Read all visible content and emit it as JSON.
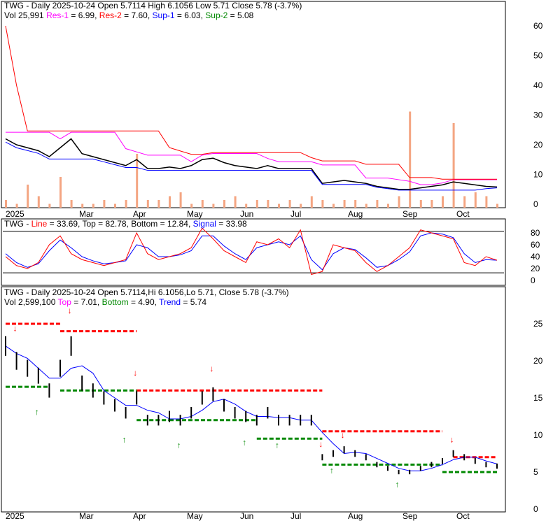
{
  "chart_data": [
    {
      "type": "line",
      "panel": "price-overview",
      "title": "TWG - Daily 2025-10-24 Open 5.7114  High 6.1056  Low 5.71  Close 5.78 (-3.7%)",
      "legend": {
        "vol": "Vol 25,991",
        "res1": "Res-1",
        "res1_val": " = 6.99,",
        "res2": "Res-2",
        "res2_val": " = 7.60,",
        "sup1": "Sup-1",
        "sup1_val": " = 6.03,",
        "sup2": "Sup-2",
        "sup2_val": " = 5.08"
      },
      "ylim": [
        0,
        65
      ],
      "yticks": [
        0,
        10,
        20,
        30,
        40,
        50,
        60
      ],
      "volume": [
        2,
        1,
        6,
        3,
        1,
        8,
        2,
        1,
        1,
        2,
        1,
        2,
        14,
        2,
        2,
        3,
        4,
        1,
        2,
        1,
        2,
        3,
        1,
        2,
        2,
        1,
        2,
        1,
        3,
        2,
        1,
        2,
        2,
        1,
        2,
        1,
        3,
        25,
        2,
        2,
        3,
        22,
        3,
        4,
        3,
        1
      ]
    },
    {
      "type": "line",
      "panel": "stochastic",
      "legend": {
        "prefix": "TWG - ",
        "line": "Line",
        "line_val": " = 33.69, Top = 82.78, Bottom = 12.84, ",
        "signal": "Signal",
        "signal_val": " = 33.98"
      },
      "ylim": [
        0,
        90
      ],
      "yticks": [
        0,
        20,
        40,
        60,
        80
      ],
      "line": [
        40,
        25,
        20,
        30,
        60,
        75,
        45,
        35,
        30,
        25,
        30,
        35,
        80,
        45,
        35,
        40,
        45,
        55,
        88,
        70,
        50,
        40,
        30,
        65,
        60,
        70,
        55,
        85,
        10,
        15,
        60,
        55,
        50,
        30,
        15,
        25,
        40,
        55,
        85,
        80,
        75,
        70,
        30,
        25,
        40,
        34
      ],
      "signal": [
        45,
        30,
        22,
        28,
        50,
        68,
        55,
        40,
        33,
        28,
        30,
        33,
        60,
        55,
        40,
        40,
        43,
        50,
        75,
        75,
        58,
        45,
        35,
        55,
        60,
        65,
        60,
        75,
        35,
        18,
        45,
        55,
        52,
        38,
        22,
        25,
        35,
        48,
        75,
        80,
        78,
        72,
        45,
        30,
        35,
        34
      ]
    },
    {
      "type": "line",
      "panel": "price-detail",
      "title": "TWG - Daily 2025-10-24 Open 5.7114,Hi 6.1056,Lo 5.71,  Close 5.78 (-3.7%)",
      "legend": {
        "vol": "Vol 2,599,100",
        "top": "Top",
        "top_val": " = 7.01,",
        "bottom": "Bottom",
        "bottom_val": " = 4.90,",
        "trend": "Trend",
        "trend_val": " = 5.74"
      },
      "ylim": [
        0,
        27
      ],
      "yticks": [
        0,
        5,
        10,
        15,
        20,
        25
      ],
      "close": [
        22,
        20,
        19,
        18,
        16,
        19,
        22,
        17,
        16,
        15,
        14,
        13,
        15,
        12,
        12,
        12.5,
        12,
        13,
        15,
        15.5,
        14,
        13,
        12.5,
        12,
        13,
        12,
        12,
        12,
        12,
        7,
        7.5,
        8,
        7.5,
        7,
        6,
        5.5,
        5,
        5,
        5.5,
        6,
        6.5,
        7.5,
        7,
        6.5,
        6,
        5.8
      ],
      "resistance": [
        [
          0,
          5,
          25
        ],
        [
          5,
          12,
          24
        ],
        [
          12,
          27,
          16
        ],
        [
          27,
          29,
          16
        ],
        [
          29,
          40,
          10.5
        ],
        [
          41,
          45,
          7
        ]
      ],
      "support": [
        [
          0,
          4,
          16.5
        ],
        [
          5,
          12,
          16
        ],
        [
          12,
          15,
          12
        ],
        [
          15,
          23,
          12
        ],
        [
          23,
          29,
          9.5
        ],
        [
          29,
          40,
          6
        ],
        [
          40,
          45,
          5
        ]
      ],
      "up_signals": [
        3,
        11,
        16,
        22,
        25,
        30,
        36
      ],
      "down_signals": [
        1,
        6,
        12,
        19,
        29,
        31,
        41
      ]
    }
  ],
  "xaxis": {
    "labels": [
      "2025",
      "Mar",
      "Apr",
      "May",
      "Jun",
      "Jul",
      "Aug",
      "Sep",
      "Oct"
    ]
  },
  "colors": {
    "res1": "#ff00ff",
    "res2": "#ff0000",
    "sup1": "#0000ff",
    "sup2": "#008000"
  }
}
